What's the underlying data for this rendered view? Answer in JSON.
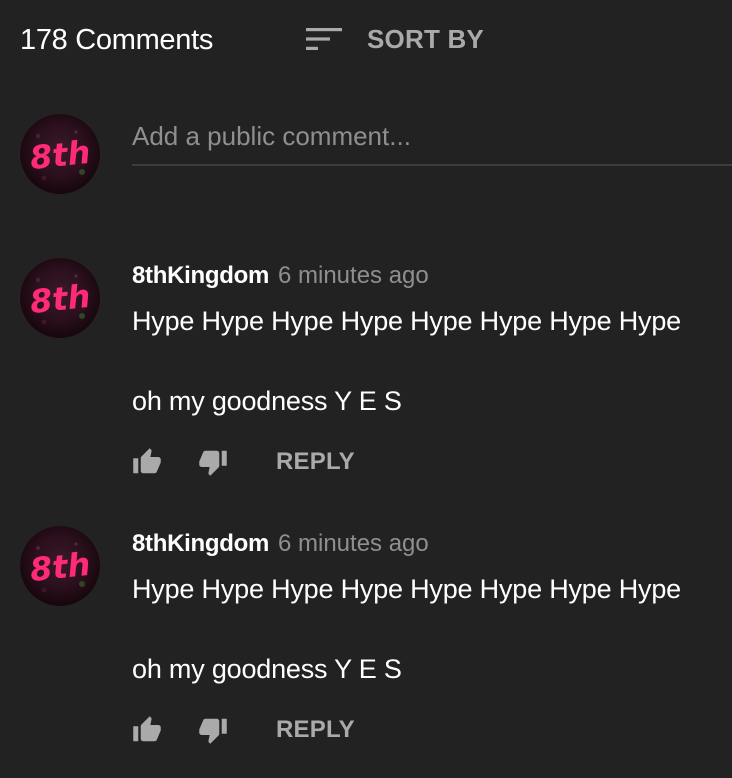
{
  "header": {
    "comment_count": "178 Comments",
    "sort_label": "SORT BY",
    "sort_icon": "sort-icon"
  },
  "add_comment": {
    "placeholder": "Add a public comment..."
  },
  "avatar": {
    "text": "8th",
    "accent": "#e8246a"
  },
  "comments": [
    {
      "author": "8thKingdom",
      "timestamp": "6 minutes ago",
      "lines": [
        "Hype Hype Hype Hype Hype Hype Hype Hype",
        "oh my goodness Y E S"
      ],
      "reply_label": "REPLY",
      "like_icon": "thumbs-up-icon",
      "dislike_icon": "thumbs-down-icon"
    },
    {
      "author": "8thKingdom",
      "timestamp": "6 minutes ago",
      "lines": [
        "Hype Hype Hype Hype Hype Hype Hype Hype",
        "oh my goodness Y E S"
      ],
      "reply_label": "REPLY",
      "like_icon": "thumbs-up-icon",
      "dislike_icon": "thumbs-down-icon"
    }
  ],
  "colors": {
    "background": "#222222",
    "text_primary": "#ffffff",
    "text_secondary": "#8f8f8f",
    "button_text": "#aaaaaa",
    "divider": "#3d3d3d"
  }
}
